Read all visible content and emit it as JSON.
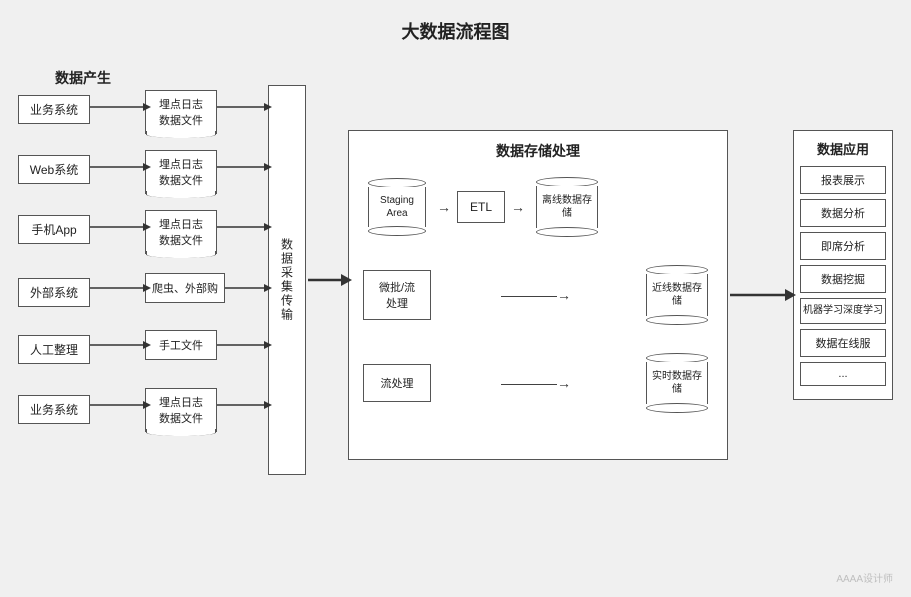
{
  "title": "大数据流程图",
  "sections": {
    "data_generation": "数据产生",
    "data_storage": "数据存储处理",
    "data_application": "数据应用"
  },
  "collection_label": "数据采集传输",
  "sources": [
    {
      "id": "s1",
      "label": "业务系统",
      "log": {
        "line1": "埋点日志",
        "line2": "数据文件"
      }
    },
    {
      "id": "s2",
      "label": "Web系统",
      "log": {
        "line1": "埋点日志",
        "line2": "数据文件"
      }
    },
    {
      "id": "s3",
      "label": "手机App",
      "log": {
        "line1": "埋点日志",
        "line2": "数据文件"
      }
    },
    {
      "id": "s4",
      "label": "外部系统",
      "log": {
        "line1": "爬虫、外部购",
        "line2": null
      }
    },
    {
      "id": "s5",
      "label": "人工整理",
      "log": {
        "line1": "手工文件",
        "line2": null
      }
    },
    {
      "id": "s6",
      "label": "业务系统",
      "log": {
        "line1": "埋点日志",
        "line2": "数据文件"
      }
    }
  ],
  "storage": {
    "rows": [
      {
        "id": "r1",
        "process": {
          "line1": "Staging",
          "line2": "Area"
        },
        "has_etl": true,
        "etl_label": "ETL",
        "db": {
          "line1": "离线数据存",
          "line2": "储"
        }
      },
      {
        "id": "r2",
        "process": {
          "line1": "微批/流",
          "line2": "处理"
        },
        "has_etl": false,
        "db": {
          "line1": "近线数据存",
          "line2": "储"
        }
      },
      {
        "id": "r3",
        "process": {
          "line1": "流处理",
          "line2": null
        },
        "has_etl": false,
        "db": {
          "line1": "实时数据存",
          "line2": "储"
        }
      }
    ]
  },
  "applications": [
    "报表展示",
    "数据分析",
    "即席分析",
    "数据挖掘",
    "机器学习深度学习",
    "数据在线服",
    "..."
  ],
  "watermark": "AAAA设计师"
}
